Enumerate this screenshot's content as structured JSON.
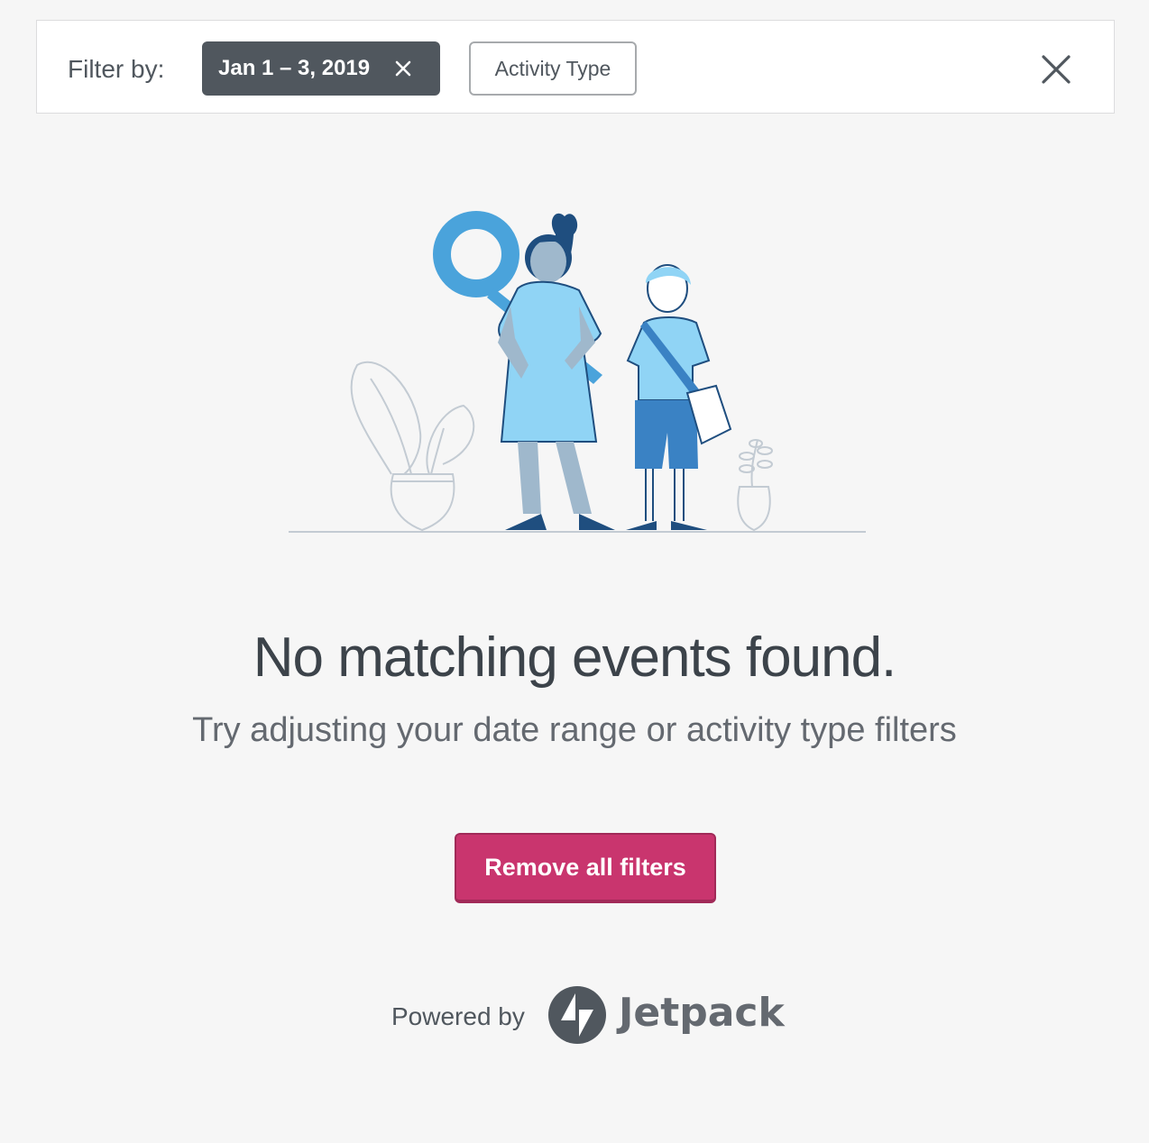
{
  "filter_bar": {
    "label": "Filter by:",
    "date_chip": "Jan 1 – 3, 2019",
    "type_chip": "Activity Type"
  },
  "empty_state": {
    "title": "No matching events found.",
    "subtitle": "Try adjusting your date range or activity type filters",
    "button": "Remove all filters"
  },
  "footer": {
    "powered_by": "Powered by",
    "brand": "Jetpack"
  },
  "icons": {
    "chip_close": "close-icon",
    "bar_close": "close-icon",
    "logo": "jetpack-logo-icon"
  },
  "colors": {
    "accent": "#c9356e",
    "chip_dark": "#50575e",
    "illustration_blue": "#4aa3db",
    "illustration_light": "#90d4f5",
    "illustration_dark": "#1f4e7f"
  }
}
